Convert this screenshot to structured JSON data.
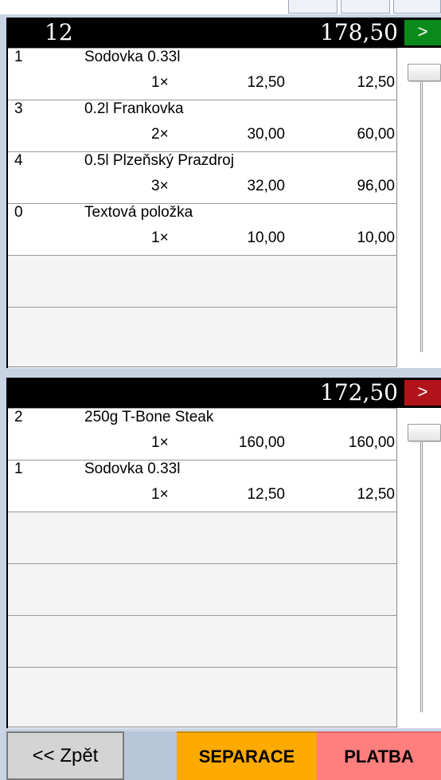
{
  "panel1": {
    "table_number": "12",
    "total": "178,50",
    "go_label": ">",
    "items": [
      {
        "idx": "1",
        "name": "Sodovka 0.33l",
        "qty": "1×",
        "price": "12,50",
        "amount": "12,50"
      },
      {
        "idx": "3",
        "name": "0.2l Frankovka",
        "qty": "2×",
        "price": "30,00",
        "amount": "60,00"
      },
      {
        "idx": "4",
        "name": "0.5l Plzeňský Prazdroj",
        "qty": "3×",
        "price": "32,00",
        "amount": "96,00"
      },
      {
        "idx": "0",
        "name": "Textová položka",
        "qty": "1×",
        "price": "10,00",
        "amount": "10,00"
      }
    ]
  },
  "panel2": {
    "table_number": "",
    "total": "172,50",
    "go_label": ">",
    "items": [
      {
        "idx": "2",
        "name": "250g T-Bone Steak",
        "qty": "1×",
        "price": "160,00",
        "amount": "160,00"
      },
      {
        "idx": "1",
        "name": "Sodovka 0.33l",
        "qty": "1×",
        "price": "12,50",
        "amount": "12,50"
      }
    ]
  },
  "footer": {
    "back_label": "<< Zpět",
    "separate_label": "SEPARACE",
    "pay_label": "PLATBA"
  },
  "colors": {
    "go_green": "#0a8a1a",
    "go_red": "#b0141a",
    "separate": "#ffaa00",
    "pay": "#ff7f7f"
  }
}
